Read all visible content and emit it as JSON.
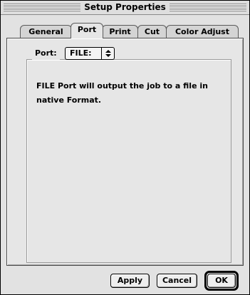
{
  "window": {
    "title": "Setup Properties"
  },
  "tabs": [
    {
      "label": "General",
      "active": false
    },
    {
      "label": "Port",
      "active": true
    },
    {
      "label": "Print",
      "active": false
    },
    {
      "label": "Cut",
      "active": false
    },
    {
      "label": "Color Adjust",
      "active": false
    }
  ],
  "port": {
    "label": "Port:",
    "selected": "FILE:",
    "description": "FILE Port will output the job to a file in native Format."
  },
  "buttons": {
    "apply": "Apply",
    "cancel": "Cancel",
    "ok": "OK"
  },
  "icons": {
    "popup_arrows": "up-down-arrows-icon"
  }
}
